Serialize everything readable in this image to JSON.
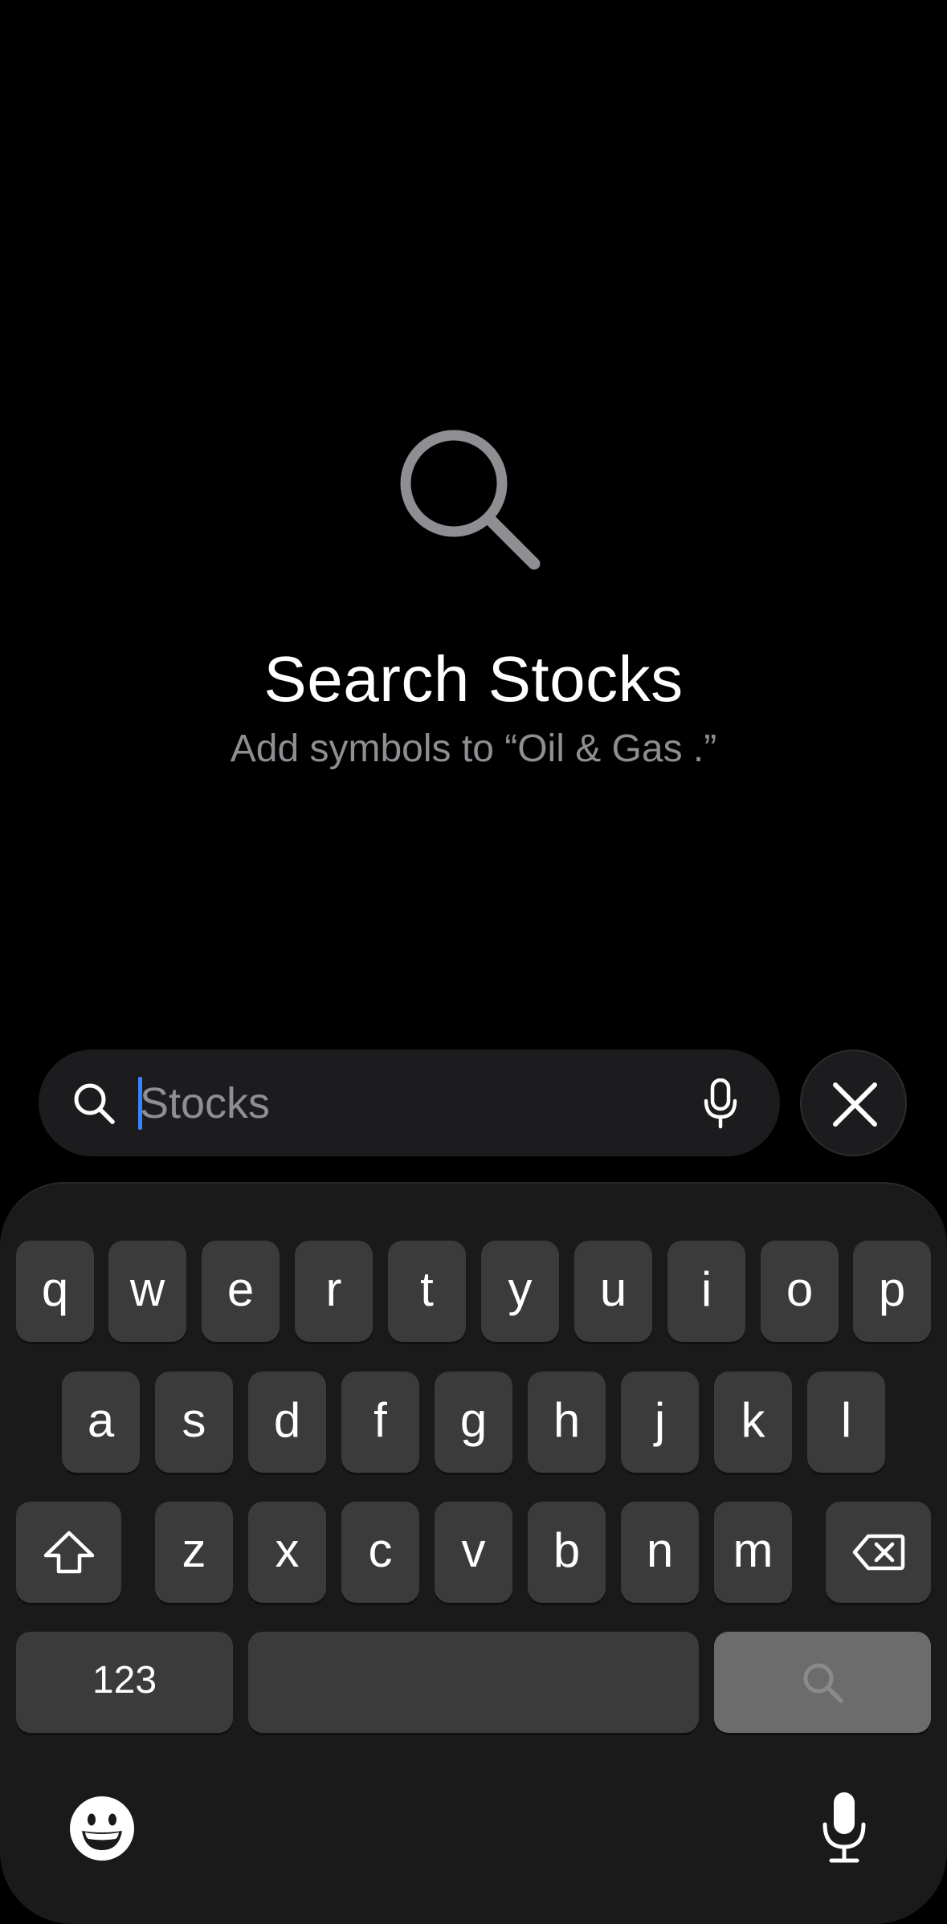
{
  "empty_state": {
    "icon": "magnifying-glass-icon",
    "title": "Search Stocks",
    "subtitle": "Add symbols to “Oil & Gas .”"
  },
  "search": {
    "placeholder": "Stocks",
    "value": "",
    "icons": [
      "search-icon",
      "microphone-icon"
    ]
  },
  "close_button": {
    "icon": "close-icon"
  },
  "keyboard": {
    "row1": [
      "q",
      "w",
      "e",
      "r",
      "t",
      "y",
      "u",
      "i",
      "o",
      "p"
    ],
    "row2": [
      "a",
      "s",
      "d",
      "f",
      "g",
      "h",
      "j",
      "k",
      "l"
    ],
    "row3": [
      "z",
      "x",
      "c",
      "v",
      "b",
      "n",
      "m"
    ],
    "numbers_label": "123",
    "icons": [
      "shift-icon",
      "delete-icon",
      "search-icon",
      "emoji-icon",
      "dictation-icon"
    ]
  },
  "colors": {
    "background": "#000000",
    "field": "#1c1c1e",
    "key": "#3b3b3b",
    "search_key": "#6c6c6c",
    "secondary_text": "#8e8e93",
    "caret": "#3a82f7"
  }
}
